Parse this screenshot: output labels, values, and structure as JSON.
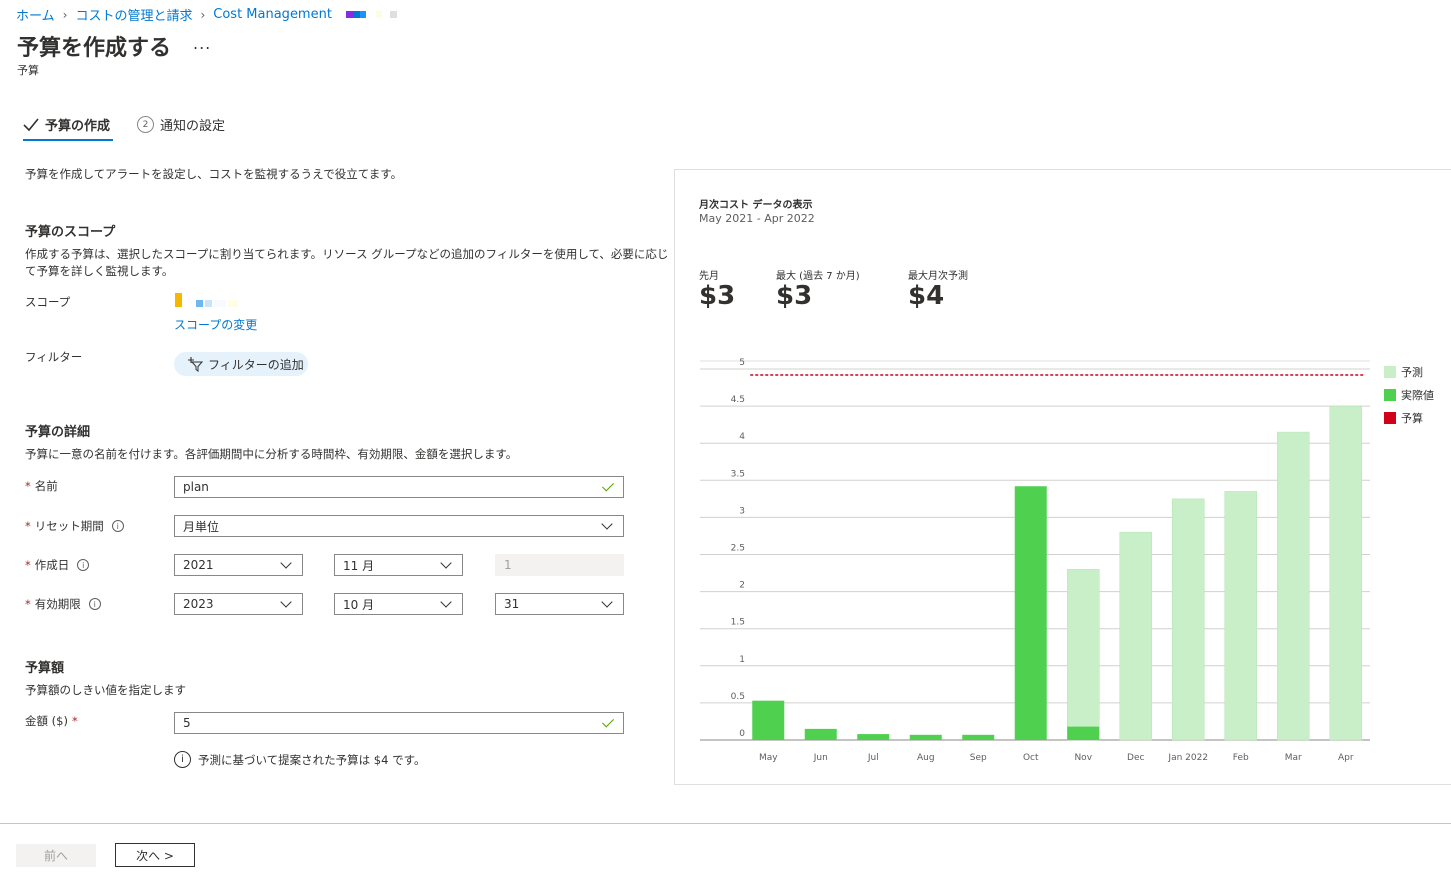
{
  "breadcrumb": {
    "home": "ホーム",
    "billing": "コストの管理と請求",
    "cost_management": "Cost Management"
  },
  "title": "予算を作成する",
  "more": "...",
  "subtitle": "予算",
  "tabs": [
    {
      "label": "予算の作成",
      "active": true
    },
    {
      "label": "通知の設定",
      "step": "2",
      "active": false
    }
  ],
  "intro": "予算を作成してアラートを設定し、コストを監視するうえで役立てます。",
  "scope_section": {
    "heading": "予算のスコープ",
    "description_line1": "作成する予算は、選択したスコープに割り当てられます。リソース グループなどの追加のフィルターを使用して、必要に応じ",
    "description_line2": "て予算を詳しく監視します。",
    "scope_label": "スコープ",
    "change_scope": "スコープの変更",
    "filter_label": "フィルター",
    "add_filter": "フィルターの追加"
  },
  "details_section": {
    "heading": "予算の詳細",
    "description": "予算に一意の名前を付けます。各評価期間中に分析する時間枠、有効期限、金額を選択します。",
    "name_label": "名前",
    "name_value": "plan",
    "reset_label": "リセット期間",
    "reset_value": "月単位",
    "created_label": "作成日",
    "created_year": "2021",
    "created_month": "11 月",
    "created_day": "1",
    "expiry_label": "有効期限",
    "expiry_year": "2023",
    "expiry_month": "10 月",
    "expiry_day": "31"
  },
  "amount_section": {
    "heading": "予算額",
    "description": "予算額のしきい値を指定します",
    "amount_label": "金額 ($)",
    "amount_value": "5",
    "suggestion": "予測に基づいて提案された予算は $4 です。"
  },
  "chart_panel": {
    "title": "月次コスト データの表示",
    "range": "May 2021 - Apr 2022",
    "kpis": [
      {
        "label": "先月",
        "value": "$3"
      },
      {
        "label": "最大 (過去 7 か月)",
        "value": "$3"
      },
      {
        "label": "最大月次予測",
        "value": "$4"
      }
    ]
  },
  "chart_data": {
    "type": "bar",
    "categories": [
      "May",
      "Jun",
      "Jul",
      "Aug",
      "Sep",
      "Oct",
      "Nov",
      "Dec",
      "Jan 2022",
      "Feb",
      "Mar",
      "Apr"
    ],
    "series": [
      {
        "name": "予測",
        "color": "#c8efc8",
        "values": [
          null,
          null,
          null,
          null,
          null,
          null,
          2.3,
          2.8,
          3.25,
          3.35,
          4.15,
          4.5
        ]
      },
      {
        "name": "実際値",
        "color": "#4fd14f",
        "values": [
          0.53,
          0.15,
          0.08,
          0.07,
          0.07,
          3.42,
          0.18,
          null,
          null,
          null,
          null,
          null
        ]
      },
      {
        "name": "予算",
        "color": "#d0021b",
        "type": "line",
        "value": 5
      }
    ],
    "yticks": [
      "0",
      "0.5",
      "1",
      "1.5",
      "2",
      "2.5",
      "3",
      "3.5",
      "4",
      "4.5",
      "5"
    ],
    "ylim": [
      0,
      5
    ],
    "legend": "right",
    "grid": true
  },
  "footer": {
    "prev": "前へ",
    "next": "次へ >"
  }
}
